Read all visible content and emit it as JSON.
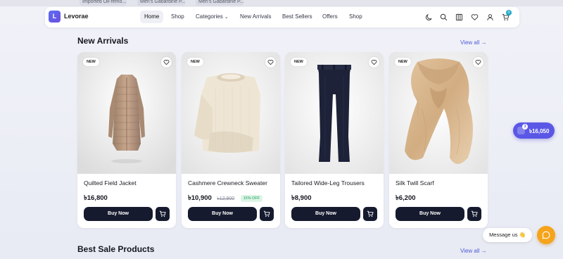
{
  "browser_tabs": [
    "Imported Oil-remo...",
    "Men's Gabardine P...",
    "Men's Gabardine P..."
  ],
  "brand": {
    "logo_letter": "L",
    "name": "Levorae"
  },
  "nav": {
    "links": [
      "Home",
      "Shop",
      "Categories",
      "New Arrivals",
      "Best Sellers",
      "Offers",
      "Shop"
    ],
    "active": "Home",
    "icons": [
      "moon-icon",
      "search-icon",
      "compare-icon",
      "heart-icon",
      "user-icon",
      "cart-icon"
    ],
    "cart_count": "0"
  },
  "new_arrivals": {
    "title": "New Arrivals",
    "view_all": "View all →",
    "products": [
      {
        "badge": "NEW",
        "name": "Quilted Field Jacket",
        "price": "৳16,800",
        "old_price": "",
        "discount": "",
        "buy_label": "Buy Now",
        "image": "quilted-coat"
      },
      {
        "badge": "NEW",
        "name": "Cashmere Crewneck Sweater",
        "price": "৳10,900",
        "old_price": "৳12,800",
        "discount": "15% OFF",
        "buy_label": "Buy Now",
        "image": "sweater"
      },
      {
        "badge": "NEW",
        "name": "Tailored Wide-Leg Trousers",
        "price": "৳8,900",
        "old_price": "",
        "discount": "",
        "buy_label": "Buy Now",
        "image": "trousers"
      },
      {
        "badge": "NEW",
        "name": "Silk Twill Scarf",
        "price": "৳6,200",
        "old_price": "",
        "discount": "",
        "buy_label": "Buy Now",
        "image": "scarf"
      }
    ]
  },
  "best_sale": {
    "title": "Best Sale Products",
    "view_all": "View all →"
  },
  "floating_cart": {
    "count": "3",
    "total": "৳16,050"
  },
  "message": {
    "label": "Message us 👋"
  },
  "colors": {
    "accent": "#5a57e6",
    "button_dark": "#161a2e",
    "chat": "#f5a41c",
    "discount_green": "#1c9b5a"
  }
}
